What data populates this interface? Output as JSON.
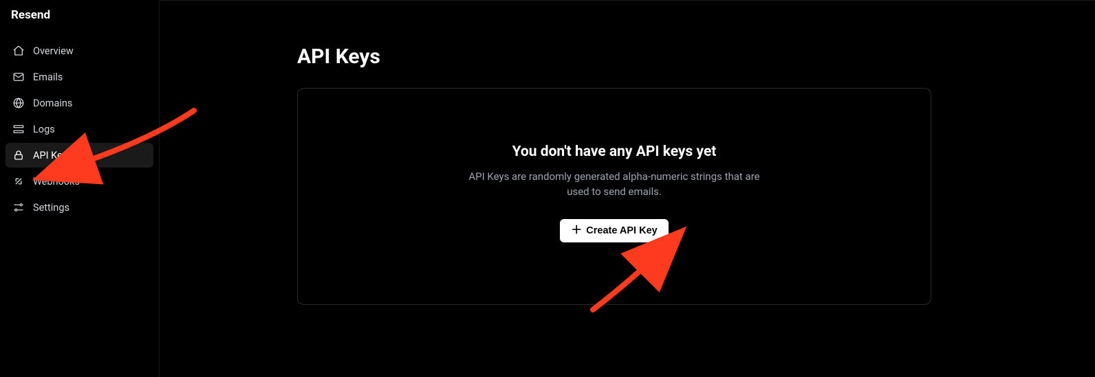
{
  "brand": "Resend",
  "sidebar": {
    "items": [
      {
        "label": "Overview"
      },
      {
        "label": "Emails"
      },
      {
        "label": "Domains"
      },
      {
        "label": "Logs"
      },
      {
        "label": "API Keys"
      },
      {
        "label": "Webhooks"
      },
      {
        "label": "Settings"
      }
    ]
  },
  "page": {
    "title": "API Keys",
    "empty_title": "You don't have any API keys yet",
    "empty_desc": "API Keys are randomly generated alpha-numeric strings that are used to send emails.",
    "create_label": "Create API Key"
  }
}
